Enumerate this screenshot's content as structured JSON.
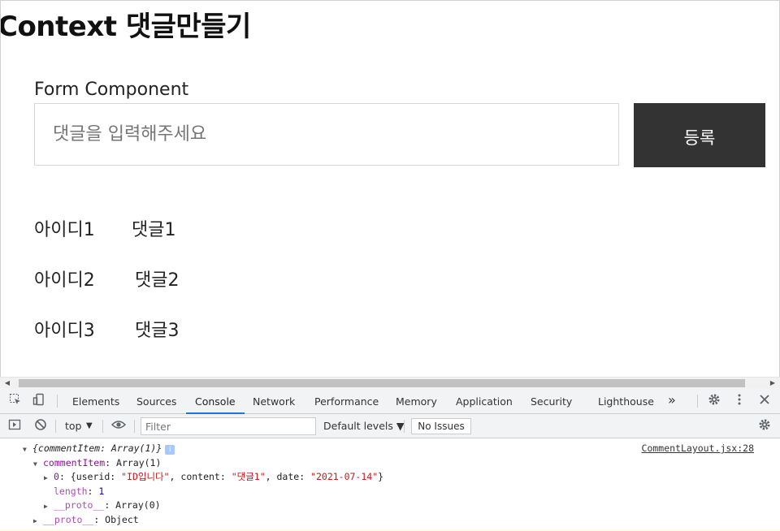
{
  "app": {
    "title": "Context 댓글만들기",
    "form_label": "Form Component",
    "input_placeholder": "댓글을 입력해주세요",
    "input_value": "",
    "submit_label": "등록"
  },
  "comments": [
    {
      "id": "아이디1",
      "text": "댓글1"
    },
    {
      "id": "아이디2",
      "text": "댓글2"
    },
    {
      "id": "아이디3",
      "text": "댓글3"
    }
  ],
  "devtools": {
    "tabs": [
      "Elements",
      "Sources",
      "Console",
      "Network",
      "Performance",
      "Memory",
      "Application",
      "Security",
      "Lighthouse"
    ],
    "active_tab": "Console",
    "more_tabs": "»",
    "context": "top",
    "context_arrow": "▼",
    "filter_placeholder": "Filter",
    "levels": "Default levels ▼",
    "issues": "No Issues",
    "icons": {
      "inspect": "inspect-element-icon",
      "device": "device-toolbar-icon",
      "settings": "gear-icon",
      "menu": "kebab-menu-icon",
      "close": "close-icon",
      "sidebar": "console-sidebar-icon",
      "clear": "clear-console-icon",
      "eye": "live-expression-eye-icon",
      "console_settings": "gear-icon"
    },
    "active_color": "#1a73e8"
  },
  "console": {
    "source_link": "CommentLayout.jsx:28",
    "line1": "{commentItem: Array(1)}",
    "info_badge": "i",
    "line2_key": "commentItem",
    "line2_value": ": Array(1)",
    "line3_index": "0",
    "line3_open": ": {userid: ",
    "line3_userid": "\"ID입니다\"",
    "line3_mid1": ", content: ",
    "line3_content": "\"댓글1\"",
    "line3_mid2": ", date: ",
    "line3_date": "\"2021-07-14\"",
    "line3_close": "}",
    "line4_key": "length",
    "line4_sep": ": ",
    "line4_value": "1",
    "line5_key": "__proto__",
    "line5_value": ": Array(0)",
    "line6_key": "__proto__",
    "line6_value": ": Object"
  }
}
